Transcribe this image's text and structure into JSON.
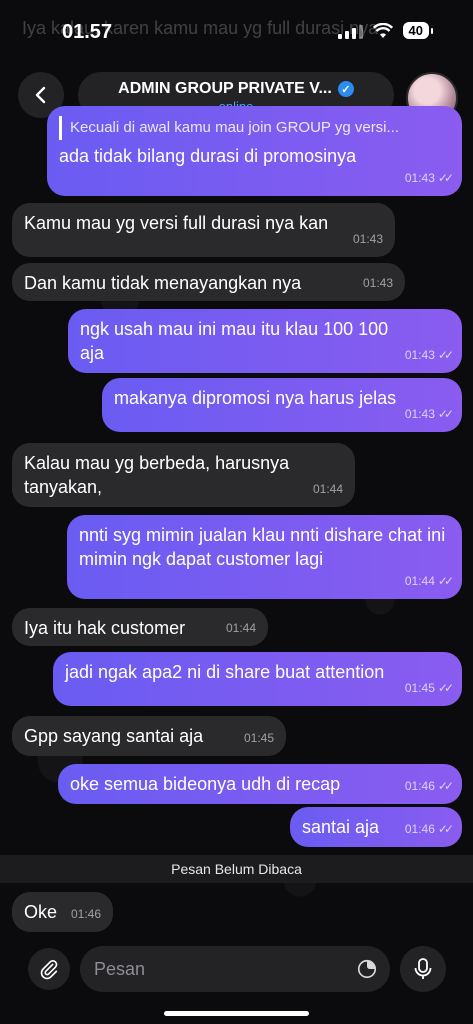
{
  "status_bar": {
    "time": "01.57",
    "battery": "40"
  },
  "ghost_text": "Iya kalau, karen kamu mau yg full durasi nya",
  "header": {
    "title": "ADMIN GROUP PRIVATE V...",
    "subtitle": "online"
  },
  "messages": [
    {
      "dir": "out",
      "reply": "Kecuali di awal kamu mau join GROUP yg versi...",
      "text": "ada tidak bilang durasi di promosinya",
      "time": "01:43"
    },
    {
      "dir": "in",
      "text": "Kamu mau yg versi full durasi nya kan",
      "time": "01:43"
    },
    {
      "dir": "in",
      "text": "Dan kamu tidak menayangkan nya",
      "time": "01:43"
    },
    {
      "dir": "out",
      "text": "ngk usah mau ini mau itu klau 100 100 aja",
      "time": "01:43"
    },
    {
      "dir": "out",
      "text": "makanya dipromosi nya harus jelas",
      "time": "01:43"
    },
    {
      "dir": "in",
      "text": "Kalau mau yg berbeda, harusnya tanyakan,",
      "time": "01:44"
    },
    {
      "dir": "out",
      "text": "nnti syg mimin jualan klau nnti dishare chat ini mimin ngk dapat customer lagi",
      "time": "01:44"
    },
    {
      "dir": "in",
      "text": "Iya itu hak customer",
      "time": "01:44"
    },
    {
      "dir": "out",
      "text": "jadi ngak apa2 ni di share buat attention",
      "time": "01:45"
    },
    {
      "dir": "in",
      "text": "Gpp sayang santai aja",
      "time": "01:45"
    },
    {
      "dir": "out",
      "text": "oke semua bideonya udh di recap",
      "time": "01:46"
    },
    {
      "dir": "out",
      "text": "santai aja",
      "time": "01:46"
    },
    {
      "dir": "in",
      "text": "Oke",
      "time": "01:46"
    }
  ],
  "unread_label": "Pesan Belum Dibaca",
  "composer": {
    "placeholder": "Pesan"
  }
}
